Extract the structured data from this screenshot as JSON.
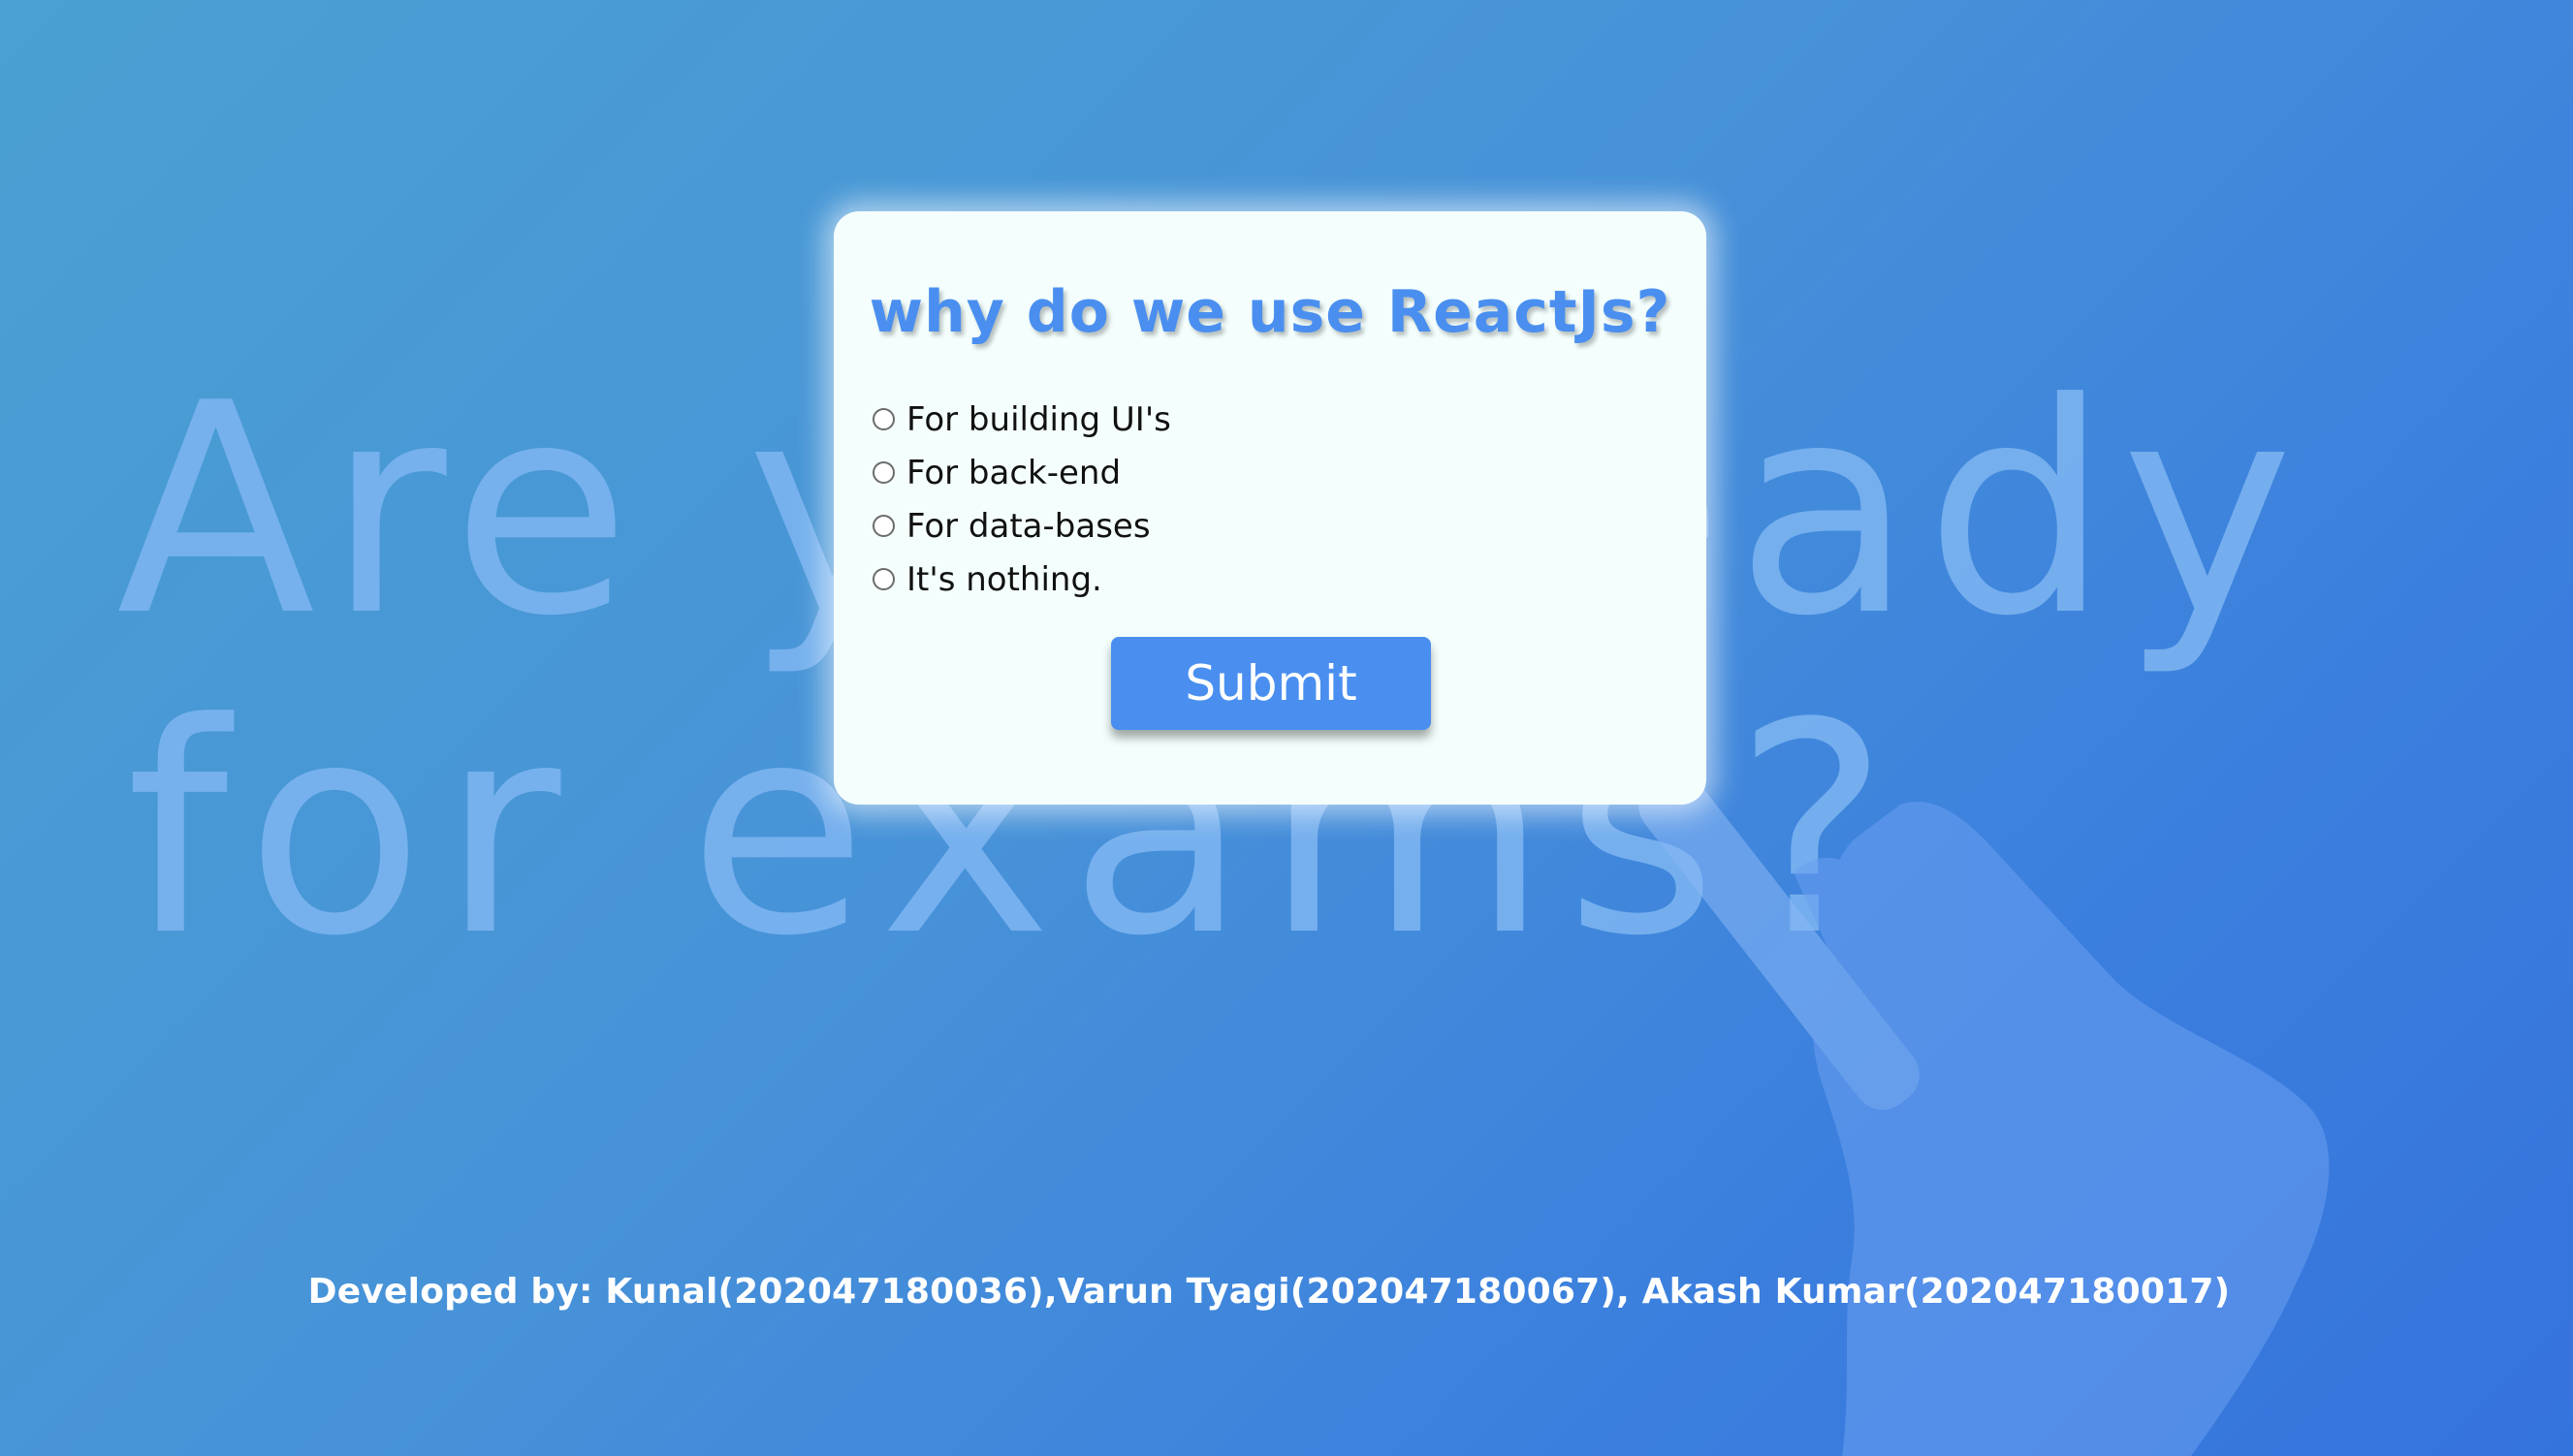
{
  "quiz": {
    "question": "why do we use ReactJs?",
    "options": [
      {
        "label": "For building UI's",
        "selected": false
      },
      {
        "label": "For back-end",
        "selected": false
      },
      {
        "label": "For data-bases",
        "selected": false
      },
      {
        "label": "It's nothing.",
        "selected": false
      }
    ],
    "submit_label": "Submit"
  },
  "background": {
    "chalk_text_line1": "Are you ready",
    "chalk_text_line2": "for exams?"
  },
  "footer": {
    "credits": "Developed by: Kunal(202047180036),Varun Tyagi(202047180067), Akash Kumar(202047180017)"
  },
  "colors": {
    "accent": "#4a8ff0",
    "card_background": "#f4fffd",
    "background_start": "#4aa0d2",
    "background_end": "#3573dc"
  }
}
